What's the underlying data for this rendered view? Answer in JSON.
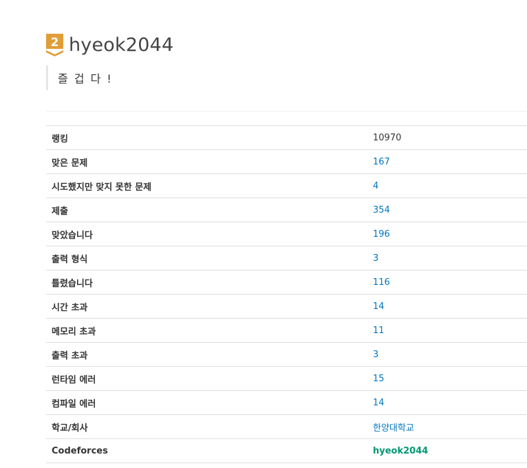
{
  "profile": {
    "tier_number": "2",
    "tier_color": "#e09e37",
    "username": "hyeok2044",
    "status_message": "즐 겁 다 !"
  },
  "stats": [
    {
      "label": "랭킹",
      "value": "10970",
      "link": false
    },
    {
      "label": "맞은 문제",
      "value": "167",
      "link": true
    },
    {
      "label": "시도했지만 맞지 못한 문제",
      "value": "4",
      "link": true
    },
    {
      "label": "제출",
      "value": "354",
      "link": true
    },
    {
      "label": "맞았습니다",
      "value": "196",
      "link": true
    },
    {
      "label": "출력 형식",
      "value": "3",
      "link": true
    },
    {
      "label": "틀렸습니다",
      "value": "116",
      "link": true
    },
    {
      "label": "시간 초과",
      "value": "14",
      "link": true
    },
    {
      "label": "메모리 초과",
      "value": "11",
      "link": true
    },
    {
      "label": "출력 초과",
      "value": "3",
      "link": true
    },
    {
      "label": "런타임 에러",
      "value": "15",
      "link": true
    },
    {
      "label": "컴파일 에러",
      "value": "14",
      "link": true
    },
    {
      "label": "학교/회사",
      "value": "한양대학교",
      "link": true
    },
    {
      "label": "Codeforces",
      "value": "hyeok2044",
      "link": true
    }
  ],
  "colors": {
    "link": "#0076c0",
    "codeforces_link": "#009874",
    "text": "#333333"
  }
}
